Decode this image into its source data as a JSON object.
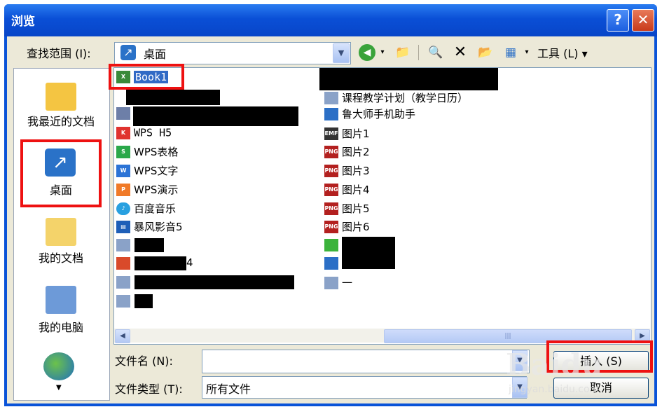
{
  "window": {
    "title": "浏览",
    "help_label": "?",
    "close_label": "✕"
  },
  "toolbar": {
    "lookin_label": "查找范围 (I):",
    "lookin_value": "桌面",
    "tools_label": "工具 (L) ▾",
    "icons": [
      "back-icon",
      "up-folder-icon",
      "search-web-icon",
      "delete-icon",
      "new-folder-icon",
      "views-icon"
    ]
  },
  "places": [
    {
      "label": "我最近的文档",
      "icon": "recent-documents-icon"
    },
    {
      "label": "桌面",
      "icon": "desktop-icon"
    },
    {
      "label": "我的文档",
      "icon": "my-documents-icon"
    },
    {
      "label": "我的电脑",
      "icon": "my-computer-icon"
    }
  ],
  "files_left": [
    {
      "name": "Book1",
      "icon": "excel-file-icon",
      "selected": true
    },
    {
      "name": "",
      "icon": "shortcut-icon"
    },
    {
      "name": "",
      "icon": "shortcut-icon"
    },
    {
      "name": "WPS H5",
      "icon": "wps-h5-icon"
    },
    {
      "name": "WPS表格",
      "icon": "wps-spreadsheet-icon"
    },
    {
      "name": "WPS文字",
      "icon": "wps-writer-icon"
    },
    {
      "name": "WPS演示",
      "icon": "wps-presentation-icon"
    },
    {
      "name": "百度音乐",
      "icon": "baidu-music-icon"
    },
    {
      "name": "暴风影音5",
      "icon": "baofeng-player-icon"
    },
    {
      "name": "",
      "icon": "word-file-icon"
    },
    {
      "name": "4",
      "icon": "ppt-file-icon"
    },
    {
      "name": "",
      "icon": "word-file-icon"
    },
    {
      "name": "",
      "icon": "word-file-icon"
    }
  ],
  "files_right": [
    {
      "name": "",
      "icon": "file-icon"
    },
    {
      "name": "课程教学计划（教学日历）",
      "icon": "word-file-icon"
    },
    {
      "name": "鲁大师手机助手",
      "icon": "ludashi-icon"
    },
    {
      "name": "图片1",
      "icon": "emf-file-icon",
      "tag": "EMF"
    },
    {
      "name": "图片2",
      "icon": "png-file-icon",
      "tag": "PNG"
    },
    {
      "name": "图片3",
      "icon": "png-file-icon",
      "tag": "PNG"
    },
    {
      "name": "图片4",
      "icon": "png-file-icon",
      "tag": "PNG"
    },
    {
      "name": "图片5",
      "icon": "png-file-icon",
      "tag": "PNG"
    },
    {
      "name": "图片6",
      "icon": "png-file-icon",
      "tag": "PNG"
    },
    {
      "name": "",
      "icon": "wechat-icon"
    },
    {
      "name": "",
      "icon": "app-icon"
    },
    {
      "name": "一",
      "icon": "word-file-icon"
    }
  ],
  "scrollbar": {
    "thumb_grip": "|||"
  },
  "bottom": {
    "filename_label": "文件名 (N):",
    "filename_value": "",
    "filetype_label": "文件类型 (T):",
    "filetype_value": "所有文件",
    "insert_label": "插入 (S)",
    "cancel_label": "取消"
  },
  "watermark": {
    "text": "Baidu",
    "subtext": "jingyan.baidu.com"
  },
  "colors": {
    "titlebar": "#0a53d8",
    "highlight": "#ee1111",
    "face": "#ece9d8"
  }
}
